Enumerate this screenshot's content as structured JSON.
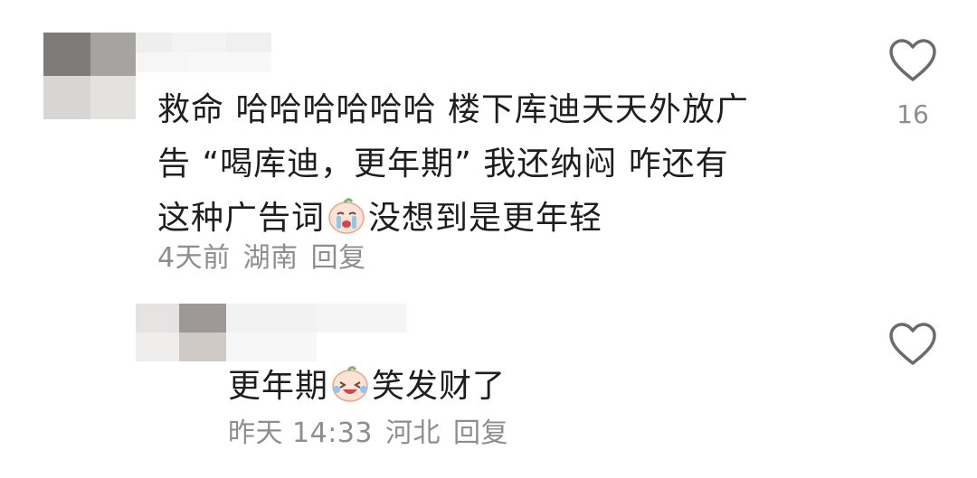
{
  "comment": {
    "lines": [
      "救命 哈哈哈哈哈哈 楼下库迪天天外放广",
      "告 “喝库迪，更年期” 我还纳闷 咋还有"
    ],
    "line3_before_emoji": "这种广告词",
    "line3_after_emoji": "没想到是更年轻",
    "emoji_name": "crying-face-emoji",
    "time": "4天前",
    "location": "湖南",
    "reply_label": "回复",
    "likes": "16"
  },
  "reply": {
    "before_emoji": "更年期",
    "after_emoji": "笑发财了",
    "emoji_name": "laughing-tears-emoji",
    "time": "昨天 14:33",
    "location": "河北",
    "reply_label": "回复"
  },
  "colors": {
    "text": "#1e1e1e",
    "meta": "#8e8e8e",
    "icon_stroke": "#6b6b6b"
  }
}
